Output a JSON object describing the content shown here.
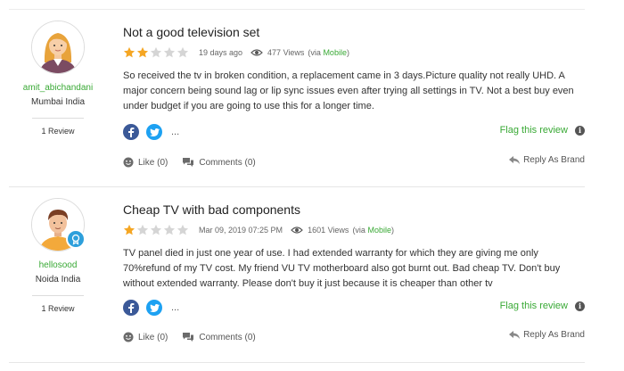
{
  "reviews": [
    {
      "user": {
        "name": "amit_abichandani",
        "location": "Mumbai India",
        "review_count": "1 Review",
        "avatar": "female-avatar"
      },
      "title": "Not a good television set",
      "rating": 2,
      "rating_max": 5,
      "date": "19 days ago",
      "views": "477 Views",
      "via_prefix": "(via ",
      "via_source": "Mobile",
      "via_suffix": ")",
      "body": "So received the tv in broken condition, a replacement came in 3 days.Picture quality not really UHD. A major concern being sound lag or lip sync issues even after trying all settings in TV. Not a best buy even under budget if you are going to use this for a longer time.",
      "more": "...",
      "flag": "Flag this review",
      "like": "Like (0)",
      "comments": "Comments (0)",
      "reply": "Reply As Brand"
    },
    {
      "user": {
        "name": "hellosood",
        "location": "Noida India",
        "review_count": "1 Review",
        "avatar": "male-avatar"
      },
      "title": "Cheap TV with bad components",
      "rating": 1,
      "rating_max": 5,
      "date": "Mar 09, 2019 07:25 PM",
      "views": "1601 Views",
      "via_prefix": "(via ",
      "via_source": "Mobile",
      "via_suffix": ")",
      "body": "TV panel died in just one year of use. I had extended warranty for which they are giving me only 70%refund of my TV cost. My friend VU TV motherboard also got burnt out. Bad cheap TV. Don't buy without extended warranty. Please don't buy it just because it is cheaper than other tv",
      "more": "...",
      "flag": "Flag this review",
      "like": "Like (0)",
      "comments": "Comments (0)",
      "reply": "Reply As Brand"
    }
  ],
  "colors": {
    "star_filled": "#f5a623",
    "star_empty": "#d5d5d5",
    "green": "#39a935",
    "facebook": "#3b5998",
    "twitter": "#1da1f2"
  }
}
